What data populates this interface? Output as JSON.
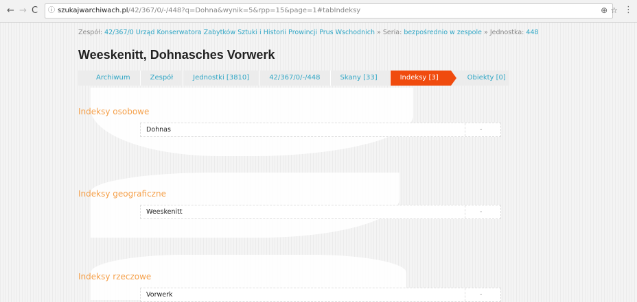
{
  "browser": {
    "nav_back": "←",
    "nav_forward": "→",
    "reload": "C",
    "info_icon": "ⓘ",
    "url_host": "szukajwarchiwach.pl",
    "url_path": "/42/367/0/-/448?q=Dohna&wynik=5&rpp=15&page=1#tabIndeksy",
    "zoom_icon": "⊕",
    "star_icon": "☆",
    "menu_icon": "⋮"
  },
  "breadcrumb": {
    "zespol_label": "Zespół:",
    "zespol_link": "42/367/0 Urząd Konserwatora Zabytków Sztuki i Historii Prowincji Prus Wschodnich",
    "seria_label": "» Seria:",
    "seria_link": "bezpośrednio w zespole",
    "jednostka_label": "» Jednostka:",
    "jednostka_link": "448"
  },
  "title": "Weeskenitt, Dohnasches Vorwerk",
  "tabs": [
    {
      "label": "Archiwum"
    },
    {
      "label": "Zespół"
    },
    {
      "label": "Jednostki [3810]"
    },
    {
      "label": "42/367/0/-/448"
    },
    {
      "label": "Skany [33]"
    },
    {
      "label": "Indeksy [3]",
      "active": true
    },
    {
      "label": "Obiekty [0]"
    }
  ],
  "sections": [
    {
      "title": "Indeksy osobowe",
      "rows": [
        {
          "name": "Dohnas",
          "value": "-"
        }
      ]
    },
    {
      "title": "Indeksy geograficzne",
      "rows": [
        {
          "name": "Weeskenitt",
          "value": "-"
        }
      ]
    },
    {
      "title": "Indeksy rzeczowe",
      "rows": [
        {
          "name": "Vorwerk",
          "value": "-"
        }
      ]
    }
  ],
  "colors": {
    "accent_link": "#2fa6c5",
    "active_tab": "#f04b0e",
    "section_title": "#f5a04a"
  }
}
